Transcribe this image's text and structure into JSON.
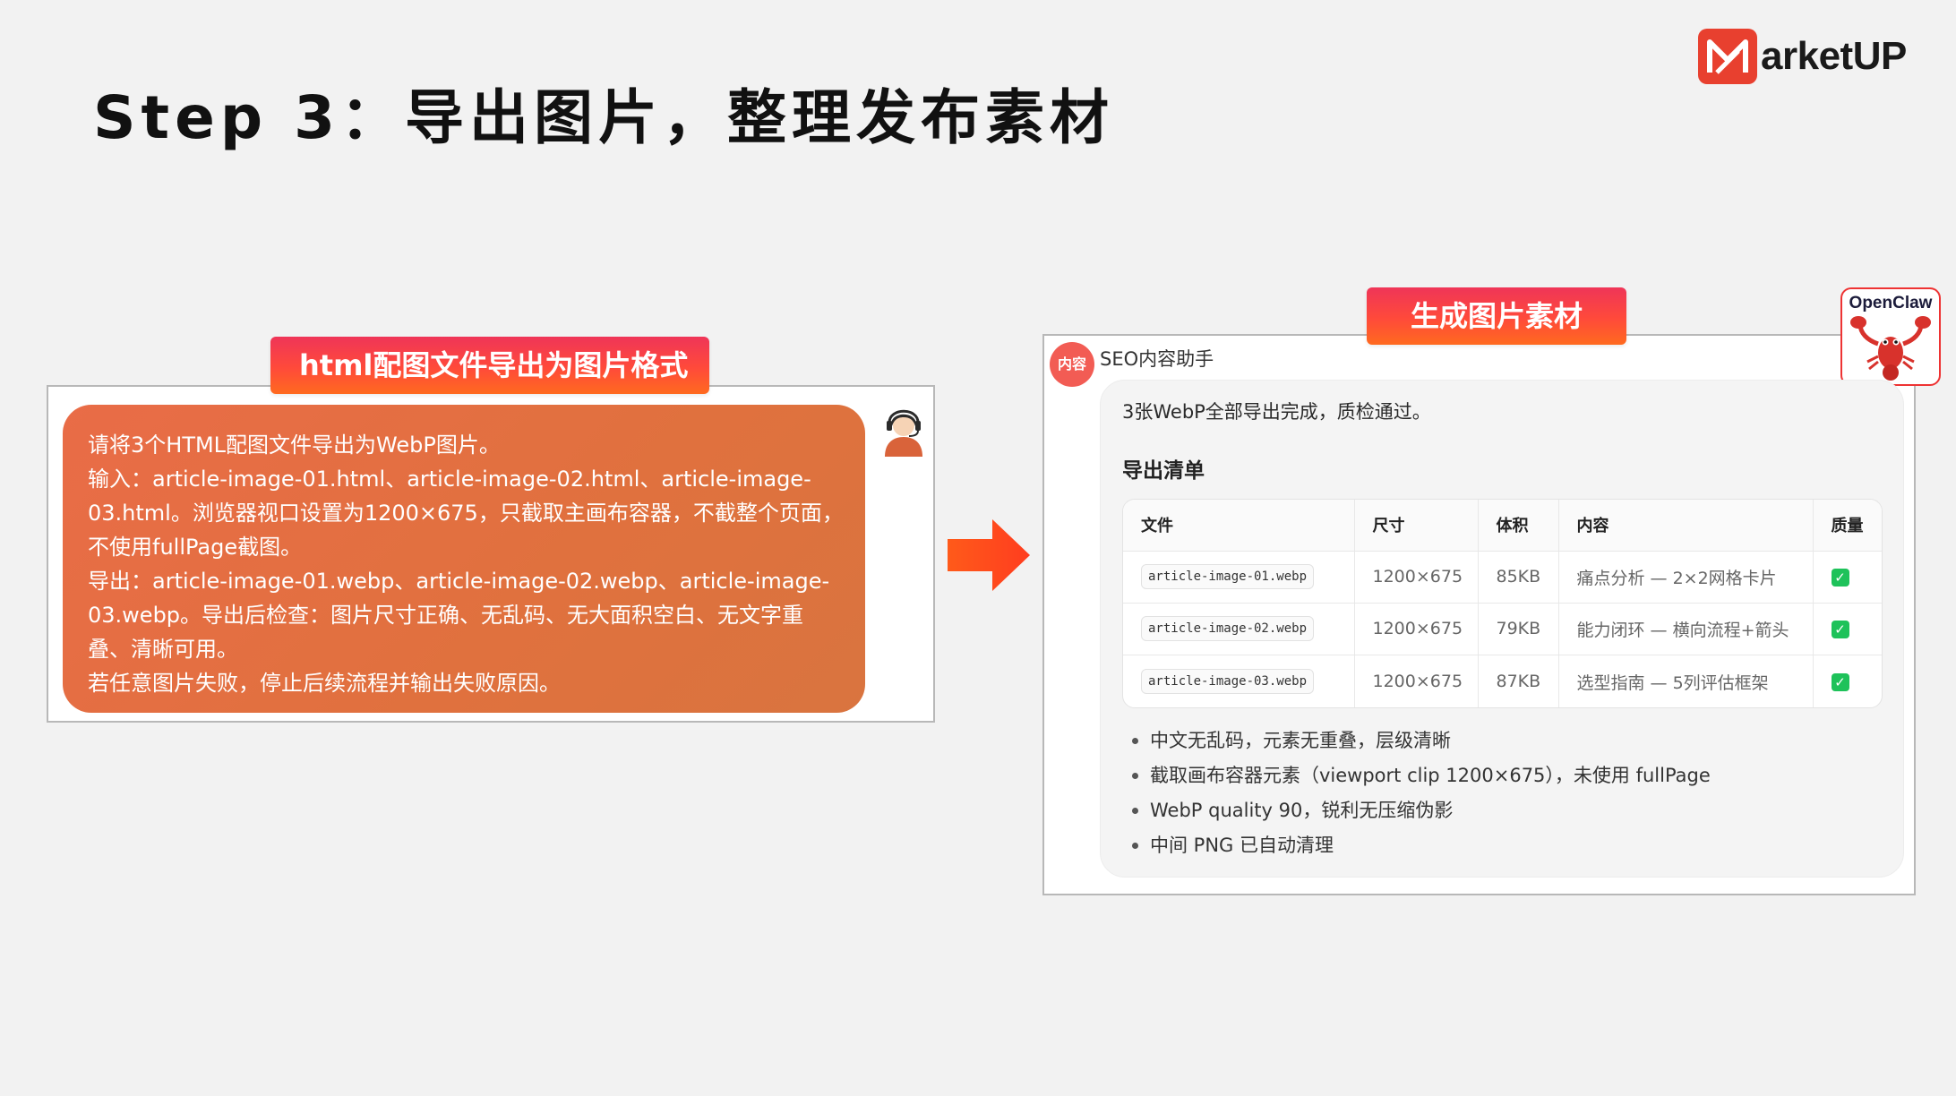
{
  "header": {
    "title": "Step 3：导出图片，整理发布素材",
    "brand_text": "arketUP"
  },
  "left": {
    "pill_label": "html配图文件导出为图片格式",
    "prompt_lines": [
      "请将3个HTML配图文件导出为WebP图片。",
      "输入：article-image-01.html、article-image-02.html、article-image-",
      "03.html。浏览器视口设置为1200×675，只截取主画布容器，不截整个页面，",
      "不使用fullPage截图。",
      "导出：article-image-01.webp、article-image-02.webp、article-image-",
      "03.webp。导出后检查：图片尺寸正确、无乱码、无大面积空白、无文字重",
      "叠、清晰可用。",
      "若任意图片失败，停止后续流程并输出失败原因。"
    ]
  },
  "right": {
    "pill_label": "生成图片素材",
    "openclaw_label": "OpenClaw",
    "assistant": {
      "avatar_text": "内容",
      "name": "SEO内容助手"
    },
    "summary": "3张WebP全部导出完成，质检通过。",
    "section_heading": "导出清单",
    "table": {
      "headers": [
        "文件",
        "尺寸",
        "体积",
        "内容",
        "质量"
      ],
      "rows": [
        {
          "file": "article-image-01.webp",
          "size": "1200×675",
          "volume": "85KB",
          "content": "痛点分析 — 2×2网格卡片",
          "quality": "✓"
        },
        {
          "file": "article-image-02.webp",
          "size": "1200×675",
          "volume": "79KB",
          "content": "能力闭环 — 横向流程+箭头",
          "quality": "✓"
        },
        {
          "file": "article-image-03.webp",
          "size": "1200×675",
          "volume": "87KB",
          "content": "选型指南 — 5列评估框架",
          "quality": "✓"
        }
      ]
    },
    "bullets": [
      "中文无乱码，元素无重叠，层级清晰",
      "截取画布容器元素（viewport clip 1200×675），未使用 fullPage",
      "WebP quality 90，锐利无压缩伪影",
      "中间 PNG 已自动清理"
    ]
  },
  "colors": {
    "accent": "#ff4a3a",
    "bubble": "#e3703f",
    "check": "#1ec25a"
  }
}
